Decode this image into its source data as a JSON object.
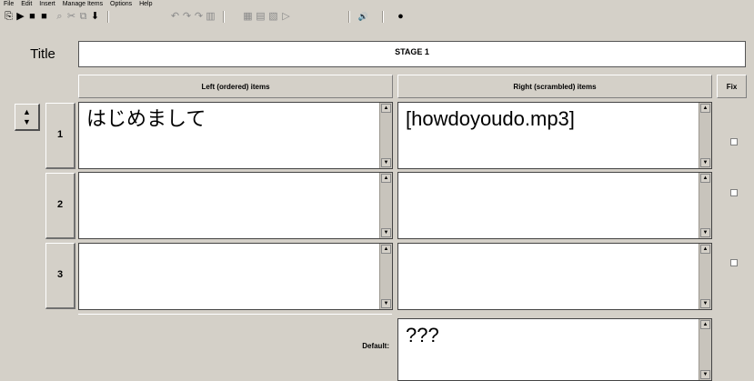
{
  "menu": [
    "File",
    "Edit",
    "Insert",
    "Manage Items",
    "Options",
    "Help"
  ],
  "toolbar": {
    "icons": [
      "new-file-icon",
      "open-folder-icon",
      "save-icon",
      "save-as-icon",
      "search-icon",
      "cut-icon",
      "copy-icon",
      "download-icon",
      "undo-icon",
      "redo-icon",
      "redo-all-icon",
      "paste-icon",
      "grid-icon",
      "grid-copy-icon",
      "grid-paste-icon",
      "grid-play-icon",
      "sound-icon",
      "record-icon"
    ],
    "glyphs": [
      "⎘",
      "▶",
      "■",
      "■",
      "⌕",
      "✂",
      "⧉",
      "⬇",
      "↶",
      "↷",
      "↷",
      "▥",
      "▦",
      "▤",
      "▧",
      "▷",
      "🔊",
      "●"
    ]
  },
  "title": {
    "label": "Title",
    "value": "STAGE 1"
  },
  "headers": {
    "left": "Left (ordered) items",
    "right": "Right (scrambled) items",
    "fix": "Fix"
  },
  "reorder": {
    "up": "▲",
    "down": "▼"
  },
  "rows": [
    {
      "number": "1",
      "left": "はじめまして",
      "right": "[howdoyoudo.mp3]"
    },
    {
      "number": "2",
      "left": "",
      "right": ""
    },
    {
      "number": "3",
      "left": "",
      "right": ""
    }
  ],
  "default": {
    "label": "Default:",
    "value": "???"
  },
  "scroll_glyphs": {
    "up": "▲",
    "down": "▼"
  }
}
